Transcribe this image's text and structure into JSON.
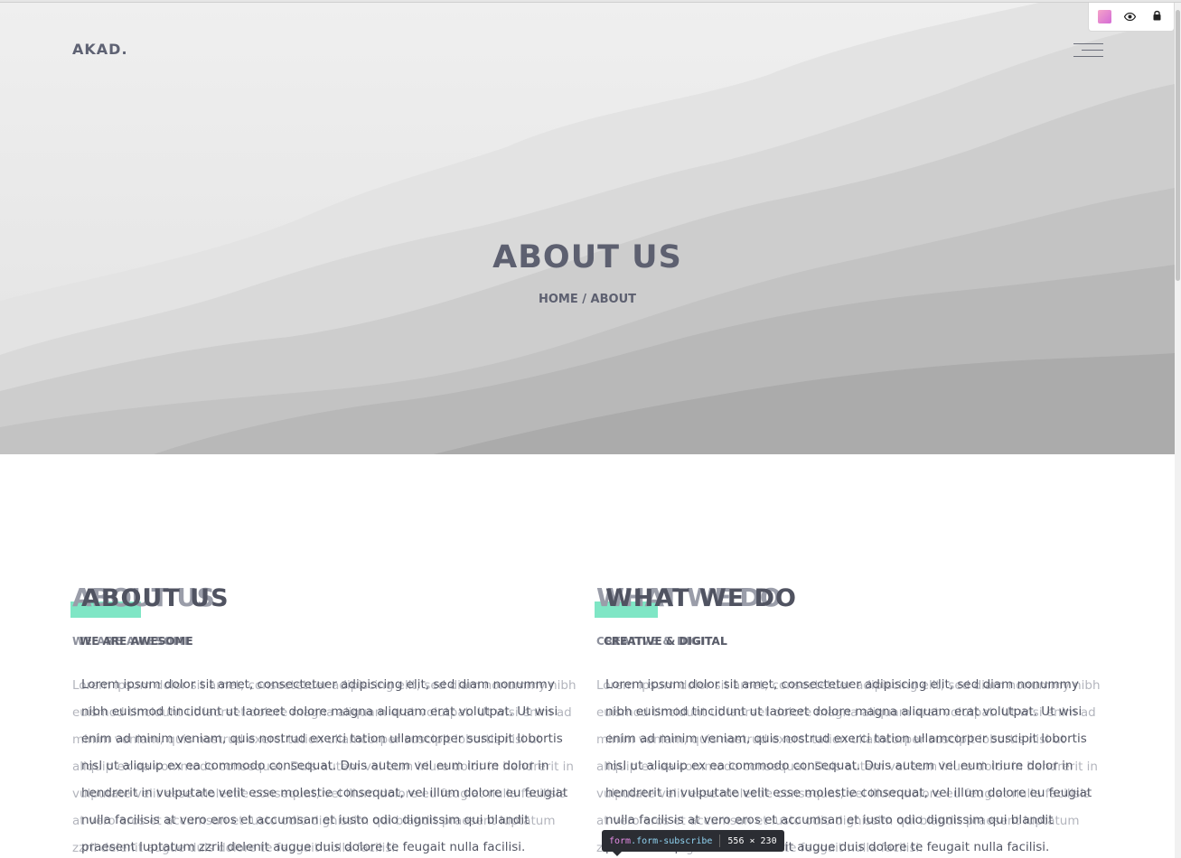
{
  "header": {
    "logo": "AKAD.",
    "menu_icon": "hamburger-menu-icon"
  },
  "hero": {
    "title": "ABOUT US",
    "breadcrumb": {
      "home": "HOME",
      "separator": "/",
      "current": "ABOUT"
    }
  },
  "devtools": {
    "icons": [
      "color-swatch-icon",
      "eye-icon",
      "lock-icon"
    ]
  },
  "columns": [
    {
      "heading": "ABOUT US",
      "heading_ghost": "ABOUT US",
      "subheading": "WE ARE AWESOME",
      "subheading_ghost": "WE ARE AWESOME",
      "text": "Lorem ipsum dolor sit amet, consectetuer adipiscing elit, sed diam nonummy nibh euismod tincidunt ut laoreet dolore magna aliquam erat volutpat. Ut wisi enim ad minim veniam, quis nostrud exerci tation ullamcorper suscipit lobortis nisl ut aliquip ex ea commodo consequat. Duis autem vel eum iriure dolor in hendrerit in vulputate velit esse molestie consequat, vel illum dolore eu feugiat nulla facilisis at vero eros et accumsan et iusto odio dignissim qui blandit praesent luptatum zzril delenit augue duis dolore te feugait nulla facilisi."
    },
    {
      "heading": "WHAT WE DO",
      "heading_ghost": "WHAT WE DO",
      "subheading": "CREATIVE & DIGITAL",
      "subheading_ghost": "CREATIVE & DIGITAL",
      "text": "Lorem ipsum dolor sit amet, consectetuer adipiscing elit, sed diam nonummy nibh euismod tincidunt ut laoreet dolore magna aliquam erat volutpat. Ut wisi enim ad minim veniam, quis nostrud exerci tation ullamcorper suscipit lobortis nisl ut aliquip ex ea commodo consequat. Duis autem vel eum iriure dolor in hendrerit in vulputate velit esse molestie consequat, vel illum dolore eu feugiat nulla facilisis at vero eros et accumsan et iusto odio dignissim qui blandit praesent luptatum zzril delenit augue duis dolore te feugait nulla facilisi."
    }
  ],
  "tooltip": {
    "tag": "form",
    "class": ".form-subscribe",
    "size": "556 × 230"
  },
  "colors": {
    "accent": "#7fe6c5",
    "heading": "#505361",
    "hero_text": "#5d6070"
  }
}
